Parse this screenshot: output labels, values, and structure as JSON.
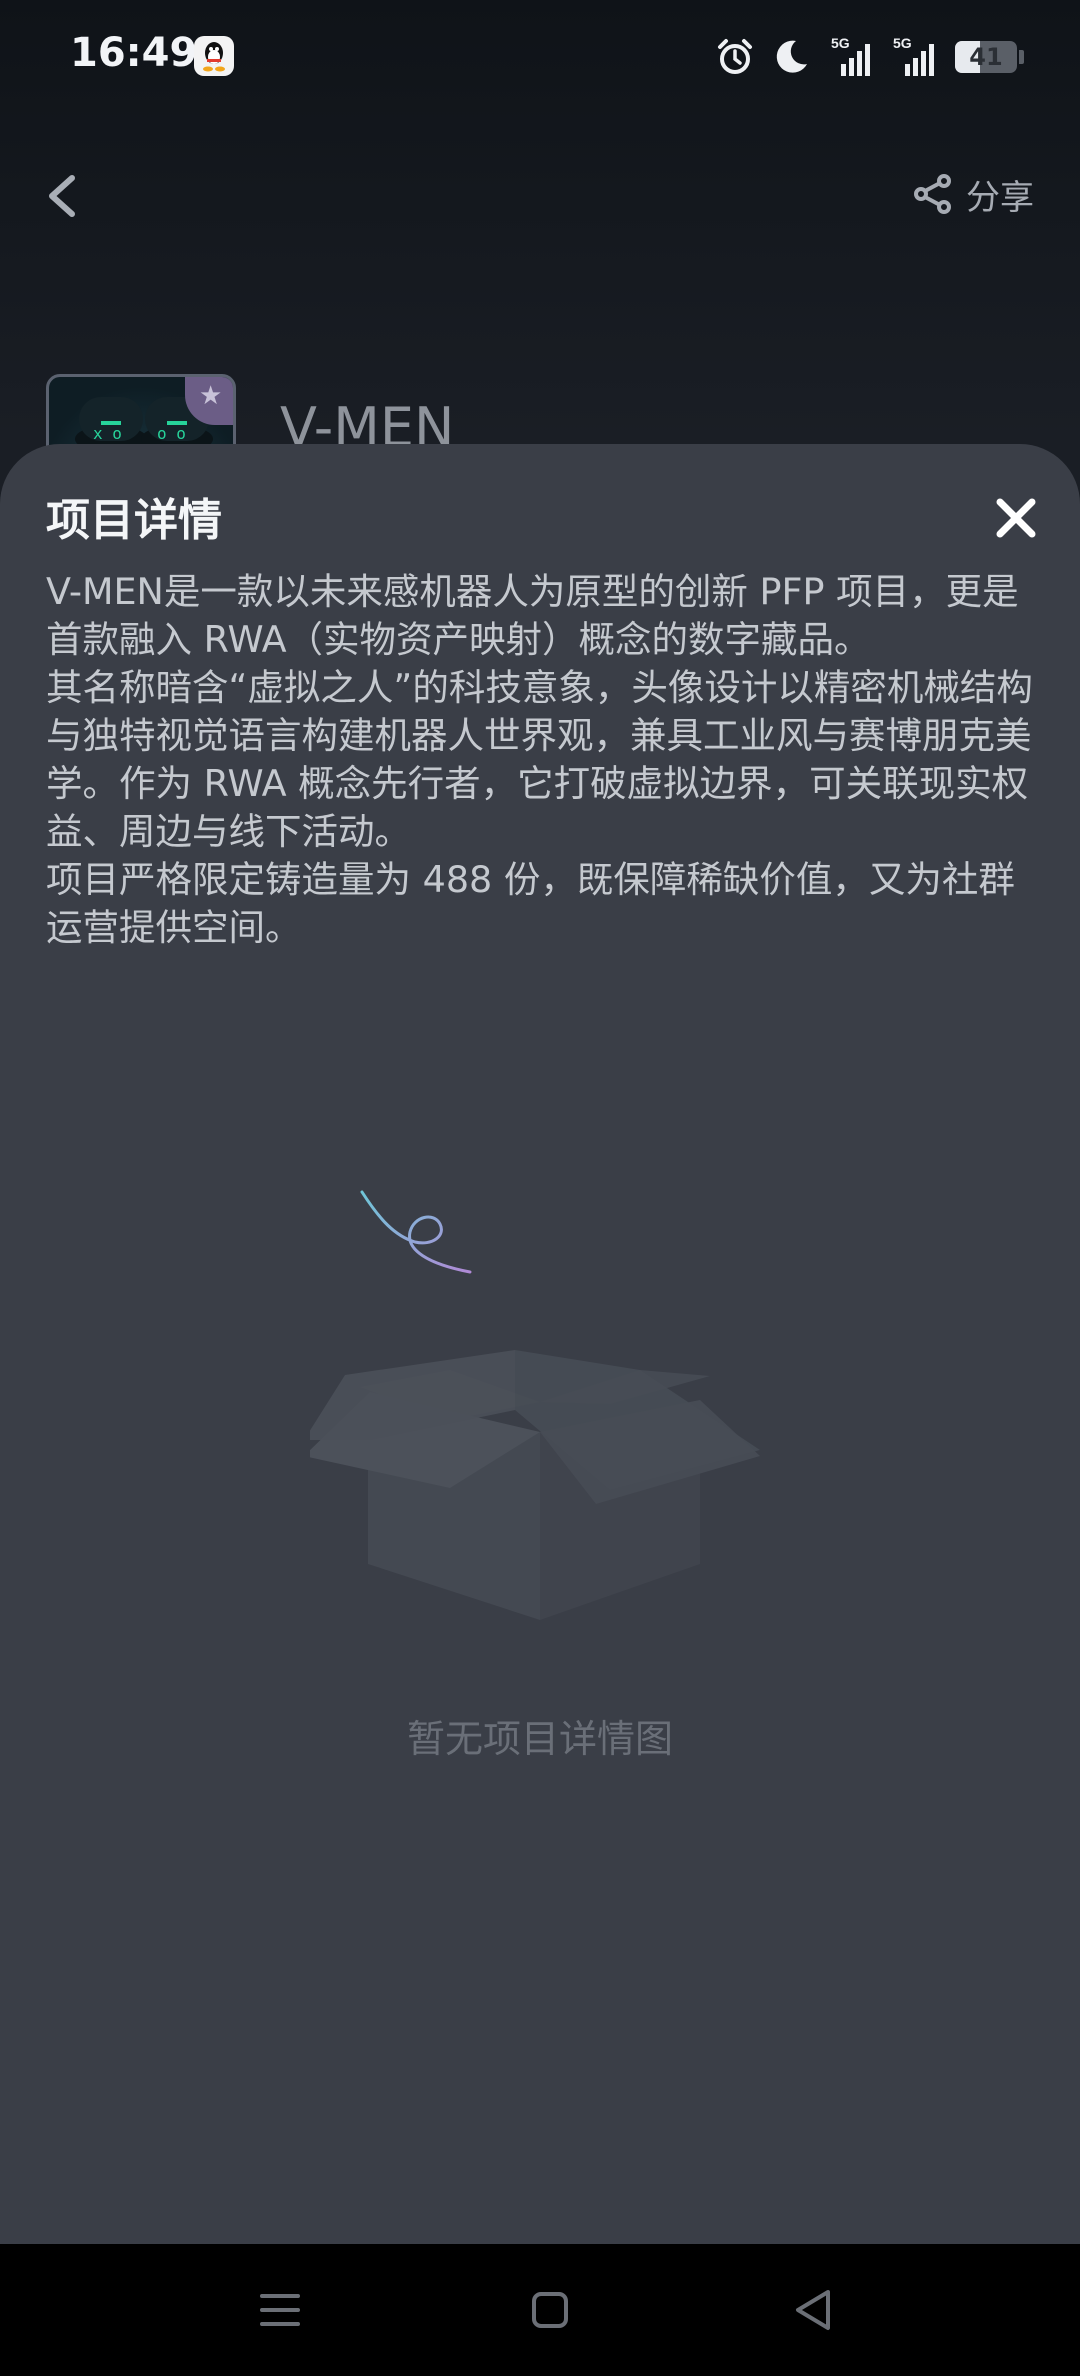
{
  "status_bar": {
    "time": "16:49",
    "battery_level": "41",
    "signal_1_label": "5G",
    "signal_2_label": "5G",
    "icons": [
      "qq-icon",
      "alarm-icon",
      "moon-icon",
      "signal-icon",
      "signal-icon",
      "battery-icon"
    ]
  },
  "header": {
    "share_label": "分享"
  },
  "project": {
    "title": "V-MEN"
  },
  "sheet": {
    "title": "项目详情",
    "paragraphs": [
      "V-MEN是一款以未来感机器人为原型的创新 PFP 项目，更是首款融入 RWA（实物资产映射）概念的数字藏品。",
      "其名称暗含“虚拟之人”的科技意象，头像设计以精密机械结构与独特视觉语言构建机器人世界观，兼具工业风与赛博朋克美学。作为 RWA 概念先行者，它打破虚拟边界，可关联现实权益、周边与线下活动。",
      "项目严格限定铸造量为 488 份，既保障稀缺价值，又为社群运营提供空间。"
    ],
    "empty_text": "暂无项目详情图"
  }
}
